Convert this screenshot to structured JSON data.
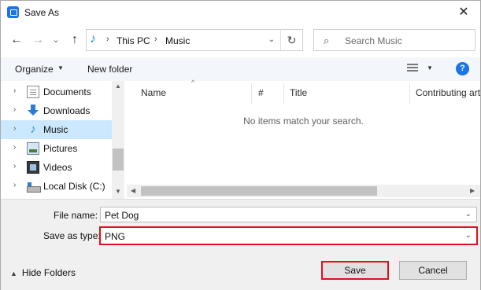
{
  "window": {
    "title": "Save As",
    "close_glyph": "✕"
  },
  "address_bar": {
    "back_glyph": "←",
    "forward_glyph": "→",
    "recent_glyph": "⌄",
    "up_glyph": "↑",
    "folder_icon": "music-note-icon",
    "crumbs": [
      "This PC",
      "Music"
    ],
    "separator": "›",
    "dropdown_glyph": "⌄",
    "refresh_glyph": "↻"
  },
  "search": {
    "icon": "⌕",
    "placeholder": "Search Music"
  },
  "toolbar": {
    "organize_label": "Organize",
    "organize_caret": "▼",
    "new_folder_label": "New folder",
    "view_caret": "▼",
    "help_label": "?"
  },
  "nav_pane": {
    "items": [
      {
        "label": "Documents",
        "icon": "documents-icon",
        "selected": false
      },
      {
        "label": "Downloads",
        "icon": "downloads-icon",
        "selected": false
      },
      {
        "label": "Music",
        "icon": "music-icon",
        "selected": true
      },
      {
        "label": "Pictures",
        "icon": "pictures-icon",
        "selected": false
      },
      {
        "label": "Videos",
        "icon": "videos-icon",
        "selected": false
      },
      {
        "label": "Local Disk (C:)",
        "icon": "local-disk-icon",
        "selected": false
      }
    ],
    "chevron": "›"
  },
  "file_list": {
    "columns": [
      "Name",
      "#",
      "Title",
      "Contributing art"
    ],
    "empty_message": "No items match your search."
  },
  "form": {
    "file_name_label": "File name:",
    "file_name_value": "Pet Dog",
    "save_type_label": "Save as type:",
    "save_type_value": "PNG",
    "dropdown_glyph": "⌄"
  },
  "footer": {
    "hide_folders_label": "Hide Folders",
    "hide_folders_glyph": "▲",
    "save_label": "Save",
    "cancel_label": "Cancel"
  },
  "colors": {
    "highlight_red": "#e0101e",
    "selection_blue": "#cce8ff",
    "accent_blue": "#1a73e8"
  }
}
